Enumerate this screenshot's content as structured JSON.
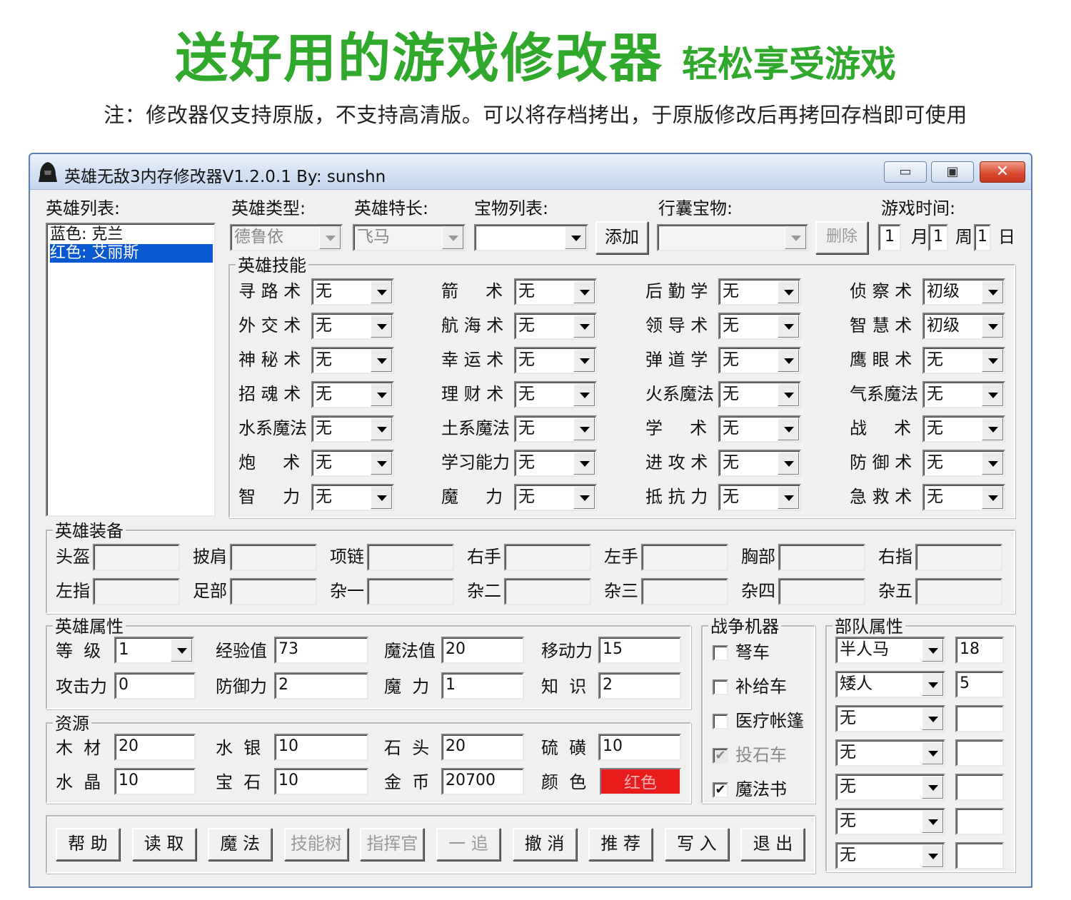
{
  "banner": {
    "headline": "送好用的游戏修改器",
    "tagline": "轻松享受游戏",
    "note": "注：修改器仅支持原版，不支持高清版。可以将存档拷出，于原版修改后再拷回存档即可使用"
  },
  "window": {
    "title": "英雄无敌3内存修改器V1.2.0.1 By: sunshn",
    "icon": "helmet-icon",
    "controls": [
      "minimize-icon",
      "maximize-icon",
      "close-icon"
    ],
    "close_glyph": "✕",
    "max_glyph": "▣",
    "min_glyph": "▭"
  },
  "hero_list": {
    "label": "英雄列表:",
    "items": [
      "蓝色: 克兰",
      "红色: 艾丽斯"
    ],
    "selected_index": 1
  },
  "top_bar": {
    "hero_type_label": "英雄类型:",
    "hero_type_value": "德鲁依",
    "specialty_label": "英雄特长:",
    "specialty_value": "飞马",
    "artifact_list_label": "宝物列表:",
    "artifact_list_value": "",
    "add_button": "添加",
    "bag_label": "行囊宝物:",
    "bag_value": "",
    "delete_button": "删除",
    "game_time_label": "游戏时间:",
    "month_value": "1",
    "month_label": "月",
    "week_value": "1",
    "week_label": "周",
    "day_value": "1",
    "day_label": "日"
  },
  "skills": {
    "title": "英雄技能",
    "items": [
      {
        "name": "寻 路 术",
        "value": "无"
      },
      {
        "name": "箭     术",
        "value": "无"
      },
      {
        "name": "后 勤 学",
        "value": "无"
      },
      {
        "name": "侦 察 术",
        "value": "初级"
      },
      {
        "name": "外 交 术",
        "value": "无"
      },
      {
        "name": "航 海 术",
        "value": "无"
      },
      {
        "name": "领 导 术",
        "value": "无"
      },
      {
        "name": "智 慧 术",
        "value": "初级"
      },
      {
        "name": "神 秘 术",
        "value": "无"
      },
      {
        "name": "幸 运 术",
        "value": "无"
      },
      {
        "name": "弹 道 学",
        "value": "无"
      },
      {
        "name": "鹰 眼 术",
        "value": "无"
      },
      {
        "name": "招 魂 术",
        "value": "无"
      },
      {
        "name": "理 财 术",
        "value": "无"
      },
      {
        "name": "火系魔法",
        "value": "无"
      },
      {
        "name": "气系魔法",
        "value": "无"
      },
      {
        "name": "水系魔法",
        "value": "无"
      },
      {
        "name": "土系魔法",
        "value": "无"
      },
      {
        "name": "学     术",
        "value": "无"
      },
      {
        "name": "战     术",
        "value": "无"
      },
      {
        "name": "炮     术",
        "value": "无"
      },
      {
        "name": "学习能力",
        "value": "无"
      },
      {
        "name": "进 攻 术",
        "value": "无"
      },
      {
        "name": "防 御 术",
        "value": "无"
      },
      {
        "name": "智     力",
        "value": "无"
      },
      {
        "name": "魔     力",
        "value": "无"
      },
      {
        "name": "抵 抗 力",
        "value": "无"
      },
      {
        "name": "急 救 术",
        "value": "无"
      }
    ]
  },
  "equipment": {
    "title": "英雄装备",
    "slots": [
      {
        "label": "头盔",
        "value": ""
      },
      {
        "label": "披肩",
        "value": ""
      },
      {
        "label": "项链",
        "value": ""
      },
      {
        "label": "右手",
        "value": ""
      },
      {
        "label": "左手",
        "value": ""
      },
      {
        "label": "胸部",
        "value": ""
      },
      {
        "label": "右指",
        "value": ""
      },
      {
        "label": "左指",
        "value": ""
      },
      {
        "label": "足部",
        "value": ""
      },
      {
        "label": "杂一",
        "value": ""
      },
      {
        "label": "杂二",
        "value": ""
      },
      {
        "label": "杂三",
        "value": ""
      },
      {
        "label": "杂四",
        "value": ""
      },
      {
        "label": "杂五",
        "value": ""
      }
    ]
  },
  "attributes": {
    "title": "英雄属性",
    "level_label": "等  级",
    "level_value": "1",
    "exp_label": "经验值",
    "exp_value": "73",
    "mana_label": "魔法值",
    "mana_value": "20",
    "move_label": "移动力",
    "move_value": "15",
    "attack_label": "攻击力",
    "attack_value": "0",
    "defense_label": "防御力",
    "defense_value": "2",
    "power_label": "魔  力",
    "power_value": "1",
    "knowledge_label": "知  识",
    "knowledge_value": "2"
  },
  "resources": {
    "title": "资源",
    "wood_label": "木  材",
    "wood_value": "20",
    "mercury_label": "水  银",
    "mercury_value": "10",
    "ore_label": "石  头",
    "ore_value": "20",
    "sulfur_label": "硫  磺",
    "sulfur_value": "10",
    "crystal_label": "水  晶",
    "crystal_value": "10",
    "gems_label": "宝  石",
    "gems_value": "10",
    "gold_label": "金  币",
    "gold_value": "20700",
    "color_label": "颜  色",
    "color_value": "红色",
    "color_hex": "#e81c1c"
  },
  "war_machines": {
    "title": "战争机器",
    "items": [
      {
        "label": "弩车",
        "checked": false,
        "disabled": false
      },
      {
        "label": "补给车",
        "checked": false,
        "disabled": false
      },
      {
        "label": "医疗帐篷",
        "checked": false,
        "disabled": false
      },
      {
        "label": "投石车",
        "checked": true,
        "disabled": true
      },
      {
        "label": "魔法书",
        "checked": true,
        "disabled": false
      }
    ]
  },
  "troops": {
    "title": "部队属性",
    "slots": [
      {
        "creature": "半人马",
        "count": "18"
      },
      {
        "creature": "矮人",
        "count": "5"
      },
      {
        "creature": "无",
        "count": ""
      },
      {
        "creature": "无",
        "count": ""
      },
      {
        "creature": "无",
        "count": ""
      },
      {
        "creature": "无",
        "count": ""
      },
      {
        "creature": "无",
        "count": ""
      }
    ]
  },
  "actions": [
    {
      "label": "帮 助",
      "disabled": false
    },
    {
      "label": "读 取",
      "disabled": false
    },
    {
      "label": "魔 法",
      "disabled": false
    },
    {
      "label": "技能树",
      "disabled": true
    },
    {
      "label": "指挥官",
      "disabled": true
    },
    {
      "label": "一 追",
      "disabled": true
    },
    {
      "label": "撤 消",
      "disabled": false
    },
    {
      "label": "推 荐",
      "disabled": false
    },
    {
      "label": "写 入",
      "disabled": false
    },
    {
      "label": "退 出",
      "disabled": false
    }
  ]
}
